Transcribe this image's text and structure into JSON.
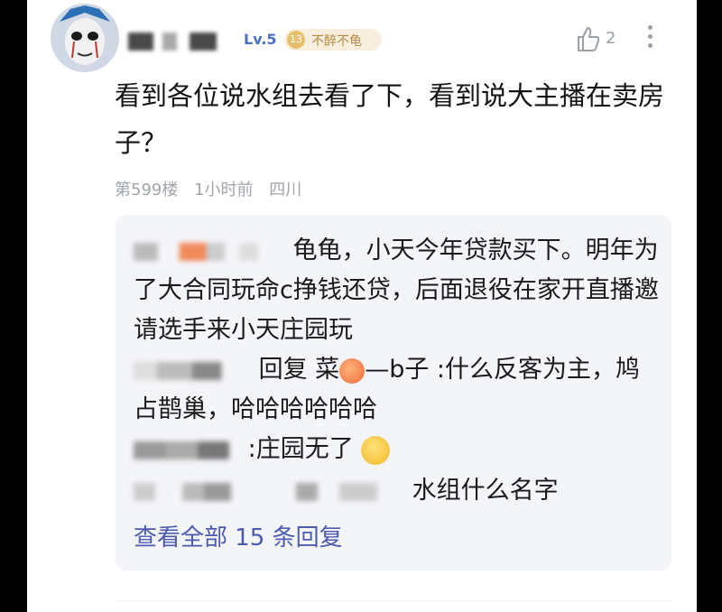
{
  "header": {
    "level": "Lv.5",
    "badge_num": "13",
    "badge_title": "不醉不龟",
    "like_count": "2"
  },
  "comment": {
    "text": "看到各位说水组去看了下，看到说大主播在卖房子？",
    "floor": "第599楼",
    "time": "1小时前",
    "location": "四川"
  },
  "replies": [
    {
      "text": "龟龟，小天今年贷款买下。明年为了大合同玩命c挣钱还贷，后面退役在家开直播邀请选手来小天庄园玩"
    },
    {
      "text_before": "回复 菜",
      "text_after": "—b子 :什么反客为主，鸠占鹊巢，哈哈哈哈哈哈"
    },
    {
      "text": ":庄园无了"
    },
    {
      "text": "水组什么名字"
    }
  ],
  "view_all": "查看全部 15 条回复",
  "colors": {
    "accent": "#4a5bb0",
    "meta": "#a0a4ab",
    "reply_bg": "#f4f5f9"
  }
}
